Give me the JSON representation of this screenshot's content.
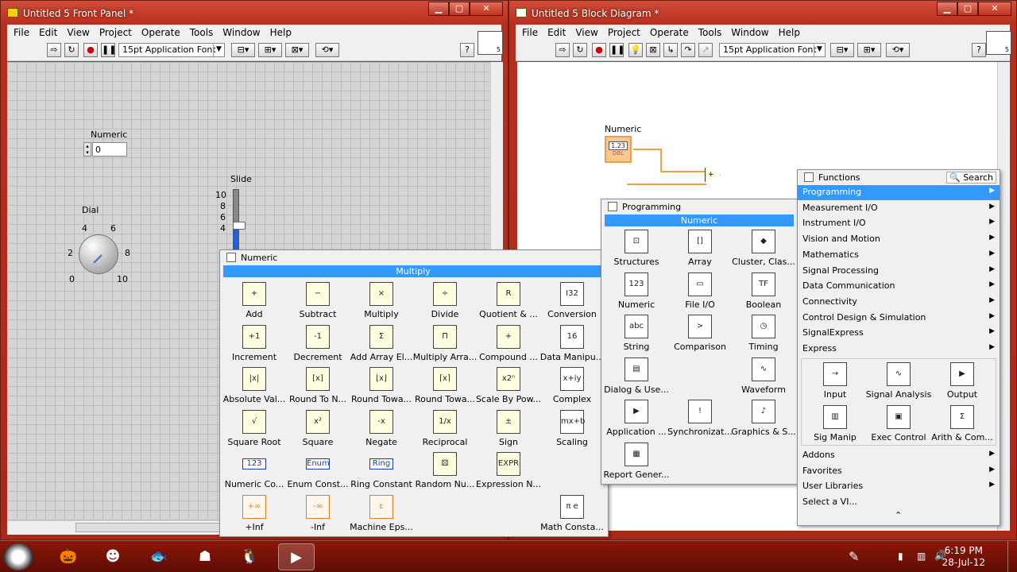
{
  "front_panel": {
    "title": "Untitled 5 Front Panel *",
    "menu": [
      "File",
      "Edit",
      "View",
      "Project",
      "Operate",
      "Tools",
      "Window",
      "Help"
    ],
    "font": "15pt Application Font",
    "vi_icon_number": "5",
    "numeric_label": "Numeric",
    "numeric_value": "0",
    "dial_label": "Dial",
    "dial_scale": [
      "0",
      "2",
      "4",
      "6",
      "8",
      "10"
    ],
    "slide_label": "Slide",
    "slide_scale": [
      "10",
      "8",
      "6",
      "4"
    ]
  },
  "block_diagram": {
    "title": "Untitled 5 Block Diagram *",
    "menu": [
      "File",
      "Edit",
      "View",
      "Project",
      "Operate",
      "Tools",
      "Window",
      "Help"
    ],
    "font": "15pt Application Font",
    "vi_icon_number": "5",
    "numeric_label": "Numeric",
    "terminal_top": "1.23",
    "terminal_bottom": "DBL"
  },
  "numeric_palette": {
    "title": "Numeric",
    "highlight": "Multiply",
    "items": [
      {
        "label": "Add",
        "icon": "+"
      },
      {
        "label": "Subtract",
        "icon": "−"
      },
      {
        "label": "Multiply",
        "icon": "×"
      },
      {
        "label": "Divide",
        "icon": "÷"
      },
      {
        "label": "Quotient & ...",
        "icon": "R"
      },
      {
        "label": "Conversion",
        "icon": "I32"
      },
      {
        "label": "Increment",
        "icon": "+1"
      },
      {
        "label": "Decrement",
        "icon": "-1"
      },
      {
        "label": "Add Array El...",
        "icon": "Σ"
      },
      {
        "label": "Multiply Arra...",
        "icon": "Π"
      },
      {
        "label": "Compound ...",
        "icon": "+"
      },
      {
        "label": "Data Manipu...",
        "icon": "16"
      },
      {
        "label": "Absolute Val...",
        "icon": "|x|"
      },
      {
        "label": "Round To N...",
        "icon": "[x]"
      },
      {
        "label": "Round Towa...",
        "icon": "⌊x⌋"
      },
      {
        "label": "Round Towa...",
        "icon": "⌈x⌉"
      },
      {
        "label": "Scale By Pow...",
        "icon": "x2ⁿ"
      },
      {
        "label": "Complex",
        "icon": "x+iy"
      },
      {
        "label": "Square Root",
        "icon": "√"
      },
      {
        "label": "Square",
        "icon": "x²"
      },
      {
        "label": "Negate",
        "icon": "-x"
      },
      {
        "label": "Reciprocal",
        "icon": "1/x"
      },
      {
        "label": "Sign",
        "icon": "±"
      },
      {
        "label": "Scaling",
        "icon": "mx+b"
      },
      {
        "label": "Numeric Co...",
        "icon": "123"
      },
      {
        "label": "Enum Const...",
        "icon": "Enum"
      },
      {
        "label": "Ring Constant",
        "icon": "Ring"
      },
      {
        "label": "Random Nu...",
        "icon": "⚄"
      },
      {
        "label": "Expression N...",
        "icon": "EXPR"
      },
      {
        "label": "",
        "icon": ""
      },
      {
        "label": "+Inf",
        "icon": "+∞"
      },
      {
        "label": "-Inf",
        "icon": "-∞"
      },
      {
        "label": "Machine Eps...",
        "icon": "ε"
      },
      {
        "label": "",
        "icon": ""
      },
      {
        "label": "",
        "icon": ""
      },
      {
        "label": "Math Consta...",
        "icon": "π e"
      }
    ]
  },
  "programming_palette": {
    "title": "Programming",
    "highlight": "Numeric",
    "items": [
      {
        "label": "Structures",
        "icon": "⊡"
      },
      {
        "label": "Array",
        "icon": "[]"
      },
      {
        "label": "Cluster, Clas...",
        "icon": "◆"
      },
      {
        "label": "Numeric",
        "icon": "123"
      },
      {
        "label": "File I/O",
        "icon": "▭"
      },
      {
        "label": "Boolean",
        "icon": "TF"
      },
      {
        "label": "String",
        "icon": "abc"
      },
      {
        "label": "Comparison",
        "icon": ">"
      },
      {
        "label": "Timing",
        "icon": "◷"
      },
      {
        "label": "Dialog & Use...",
        "icon": "▤"
      },
      {
        "label": "",
        "icon": ""
      },
      {
        "label": "Waveform",
        "icon": "∿"
      },
      {
        "label": "Application ...",
        "icon": "▶"
      },
      {
        "label": "Synchronizat...",
        "icon": "!"
      },
      {
        "label": "Graphics & S...",
        "icon": "♪"
      },
      {
        "label": "Report Gener...",
        "icon": "▦"
      }
    ]
  },
  "functions_palette": {
    "title": "Functions",
    "search": "Search",
    "categories": [
      {
        "label": "Programming",
        "selected": true
      },
      {
        "label": "Measurement I/O",
        "selected": false
      },
      {
        "label": "Instrument I/O",
        "selected": false
      },
      {
        "label": "Vision and Motion",
        "selected": false
      },
      {
        "label": "Mathematics",
        "selected": false
      },
      {
        "label": "Signal Processing",
        "selected": false
      },
      {
        "label": "Data Communication",
        "selected": false
      },
      {
        "label": "Connectivity",
        "selected": false
      },
      {
        "label": "Control Design & Simulation",
        "selected": false
      },
      {
        "label": "SignalExpress",
        "selected": false
      },
      {
        "label": "Express",
        "selected": false
      }
    ],
    "express_items": [
      {
        "label": "Input",
        "icon": "→"
      },
      {
        "label": "Signal Analysis",
        "icon": "∿"
      },
      {
        "label": "Output",
        "icon": "▶"
      },
      {
        "label": "Sig Manip",
        "icon": "▥"
      },
      {
        "label": "Exec Control",
        "icon": "▣"
      },
      {
        "label": "Arith & Com...",
        "icon": "Σ"
      }
    ],
    "bottom": [
      {
        "label": "Addons",
        "arrow": true
      },
      {
        "label": "Favorites",
        "arrow": true
      },
      {
        "label": "User Libraries",
        "arrow": true
      },
      {
        "label": "Select a VI...",
        "arrow": false
      }
    ],
    "collapse": "⌃"
  },
  "taskbar": {
    "time": "6:19 PM",
    "date": "28-Jul-12"
  }
}
